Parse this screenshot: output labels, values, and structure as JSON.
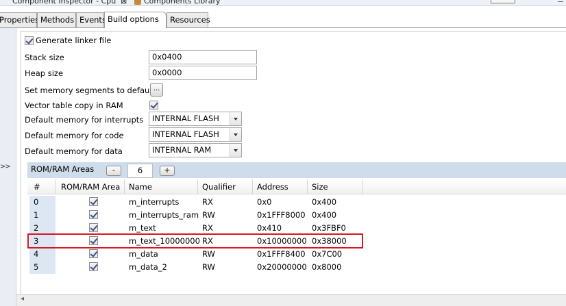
{
  "top_strip": {
    "component_inspector_tab": "Component Inspector - Cpu",
    "close_glyph": "⊠",
    "components_library_tab": "Components Library"
  },
  "tabs": [
    {
      "label": "Properties",
      "active": false
    },
    {
      "label": "Methods",
      "active": false
    },
    {
      "label": "Events",
      "active": false
    },
    {
      "label": "Build options",
      "active": true
    },
    {
      "label": "Resources",
      "active": false
    }
  ],
  "left_gutter": {
    "expand_label": ">>"
  },
  "build_options": {
    "generate_linker_file": {
      "label": "Generate linker file",
      "checked": true
    },
    "stack_size": {
      "label": "Stack size",
      "value": "0x0400"
    },
    "heap_size": {
      "label": "Heap size",
      "value": "0x0000"
    },
    "set_memory_segments": {
      "label": "Set memory segments to default",
      "button": "..."
    },
    "vector_table_copy": {
      "label": "Vector table copy in RAM",
      "checked": true
    },
    "default_memory_interrupts": {
      "label": "Default memory for interrupts",
      "value": "INTERNAL FLASH"
    },
    "default_memory_code": {
      "label": "Default memory for code",
      "value": "INTERNAL FLASH"
    },
    "default_memory_data": {
      "label": "Default memory for data",
      "value": "INTERNAL RAM"
    }
  },
  "rom_ram_areas": {
    "title": "ROM/RAM Areas",
    "minus_label": "-",
    "count": "6",
    "plus_label": "+",
    "columns": [
      "#",
      "ROM/RAM Area",
      "Name",
      "Qualifier",
      "Address",
      "Size"
    ],
    "rows": [
      {
        "num": "0",
        "area_checked": true,
        "name": "m_interrupts",
        "qualifier": "RX",
        "address": "0x0",
        "size": "0x400"
      },
      {
        "num": "1",
        "area_checked": true,
        "name": "m_interrupts_ram",
        "qualifier": "RW",
        "address": "0x1FFF8000",
        "size": "0x400"
      },
      {
        "num": "2",
        "area_checked": true,
        "name": "m_text",
        "qualifier": "RX",
        "address": "0x410",
        "size": "0x3FBF0"
      },
      {
        "num": "3",
        "area_checked": true,
        "name": "m_text_10000000",
        "qualifier": "RX",
        "address": "0x10000000",
        "size": "0x38000"
      },
      {
        "num": "4",
        "area_checked": true,
        "name": "m_data",
        "qualifier": "RW",
        "address": "0x1FFF8400",
        "size": "0x7C00"
      },
      {
        "num": "5",
        "area_checked": true,
        "name": "m_data_2",
        "qualifier": "RW",
        "address": "0x20000000",
        "size": "0x8000"
      }
    ],
    "highlighted_row": "3",
    "highlight_color": "#d4181f"
  },
  "scrollbar": {
    "left_arrow": "◂"
  }
}
